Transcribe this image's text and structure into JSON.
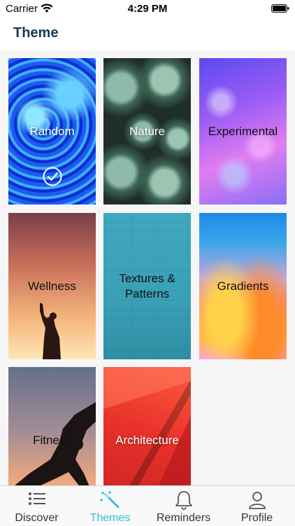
{
  "status_bar": {
    "carrier": "Carrier",
    "time": "4:29 PM"
  },
  "header": {
    "title": "Theme"
  },
  "themes": [
    {
      "label": "Random",
      "selected": true
    },
    {
      "label": "Nature"
    },
    {
      "label": "Experimental"
    },
    {
      "label": "Wellness"
    },
    {
      "label": "Textures &\nPatterns"
    },
    {
      "label": "Gradients"
    },
    {
      "label": "Fitness"
    },
    {
      "label": "Architecture"
    }
  ],
  "tabbar": {
    "items": [
      {
        "label": "Discover",
        "icon": "list-icon"
      },
      {
        "label": "Themes",
        "icon": "magic-wand-icon",
        "active": true
      },
      {
        "label": "Reminders",
        "icon": "bell-icon"
      },
      {
        "label": "Profile",
        "icon": "person-icon"
      }
    ]
  },
  "colors": {
    "accent": "#2fc3cf",
    "title": "#153a50"
  }
}
